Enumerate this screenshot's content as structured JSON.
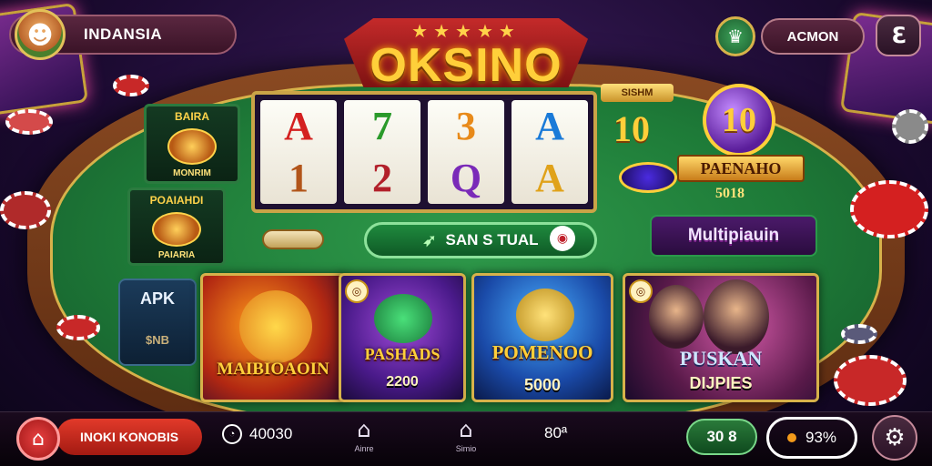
{
  "header": {
    "region_label": "INDANSIA",
    "account_label": "ACMON",
    "avatar_icon": "☻",
    "wallet_icon": "♛",
    "exit_icon": "ℇ",
    "logo": {
      "stars": "★★★★★",
      "title": "OKSINO"
    }
  },
  "reels": [
    {
      "symbols": [
        "A",
        "1"
      ],
      "colors": [
        "#d42020",
        "#b2551a"
      ]
    },
    {
      "symbols": [
        "7",
        "2"
      ],
      "colors": [
        "#2a9a2a",
        "#b2202a"
      ]
    },
    {
      "symbols": [
        "3",
        "Q"
      ],
      "colors": [
        "#e88a1a",
        "#7a2ab8"
      ]
    },
    {
      "symbols": [
        "A",
        "A"
      ],
      "colors": [
        "#1a7ad8",
        "#e0a21a"
      ]
    }
  ],
  "left_cards": [
    {
      "title": "BAIRA",
      "caption": "MONRIM"
    },
    {
      "title": "POAIAHDI",
      "caption": "PAIARIA"
    }
  ],
  "apk_card": {
    "label": "APK",
    "sub": "$NB"
  },
  "right_panel": {
    "small_label": "SISHM",
    "small_value": "10",
    "orb_value": "10",
    "bonus_title": "PAENAHO",
    "bonus_value": "5018",
    "multiplier": "Multipiauin"
  },
  "spin": {
    "label": "SAN S TUAL",
    "icon": "➶",
    "indicator": "◉"
  },
  "tiles": [
    {
      "title": "MAIBIOAOIN",
      "value": ""
    },
    {
      "title": "PASHADS",
      "value": "2200"
    },
    {
      "title": "POMENOO",
      "value": "5000"
    },
    {
      "title": "PUSKAN",
      "value": "DIJPIES"
    }
  ],
  "bottom_bar": {
    "home_icon": "⌂",
    "promo_label": "INOKI KONOBIS",
    "timer_icon": "◔",
    "timer_value": "40030",
    "nav": [
      {
        "icon": "⌂",
        "label": "Ainre"
      },
      {
        "icon": "⌂",
        "label": "Simio"
      }
    ],
    "counter": "80ª",
    "bet_label": "30 8",
    "percent": "93%",
    "settings_icon": "⚙"
  },
  "colors": {
    "felt": "#1e7b38",
    "gold": "#d7b24a",
    "accent_red": "#d42020"
  }
}
